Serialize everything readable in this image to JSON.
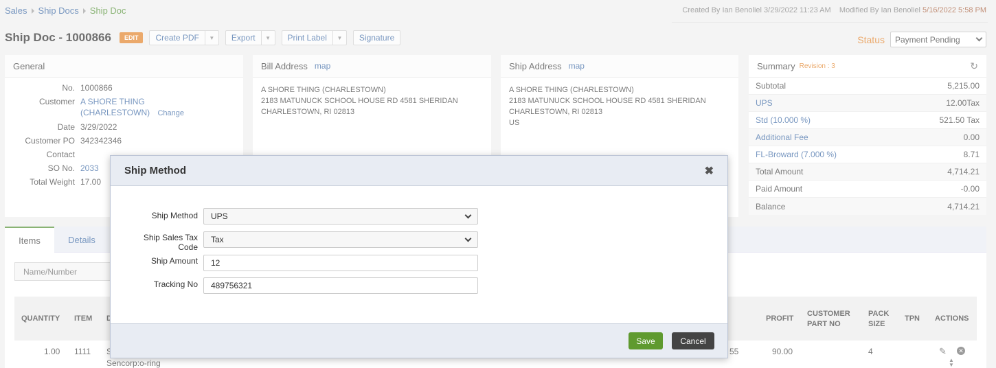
{
  "breadcrumb": [
    "Sales",
    "Ship Docs",
    "Ship Doc"
  ],
  "meta": {
    "created_label": "Created By",
    "created_by": "Ian Benoliel 3/29/2022 11:23 AM",
    "modified_label": "Modified By",
    "modified_by_name": "Ian Benoliel",
    "modified_date": "5/16/2022 5:58 PM"
  },
  "title": "Ship Doc - 1000866",
  "edit_badge": "EDIT",
  "toolbar": {
    "create_pdf": "Create PDF",
    "export": "Export",
    "print_label": "Print Label",
    "signature": "Signature"
  },
  "status": {
    "label": "Status",
    "value": "Payment Pending"
  },
  "general": {
    "title": "General",
    "rows": [
      {
        "k": "No.",
        "v": "1000866"
      },
      {
        "k": "Customer",
        "v": "A SHORE THING",
        "v2": "(CHARLESTOWN)",
        "change": "Change"
      },
      {
        "k": "Date",
        "v": "3/29/2022"
      },
      {
        "k": "Customer PO",
        "v": "342342346"
      },
      {
        "k": "Contact",
        "v": ""
      },
      {
        "k": "SO No.",
        "v": "2033"
      },
      {
        "k": "Total Weight",
        "v": "17.00"
      }
    ]
  },
  "bill": {
    "title": "Bill Address",
    "map": "map",
    "lines": [
      "A SHORE THING (CHARLESTOWN)",
      "2183 MATUNUCK SCHOOL HOUSE RD 4581 SHERIDAN",
      "CHARLESTOWN, RI 02813"
    ]
  },
  "ship": {
    "title": "Ship Address",
    "map": "map",
    "lines": [
      "A SHORE THING (CHARLESTOWN)",
      "2183 MATUNUCK SCHOOL HOUSE RD 4581 SHERIDAN",
      "CHARLESTOWN, RI 02813",
      "US"
    ]
  },
  "summary": {
    "title": "Summary",
    "revision": "Revision : 3",
    "rows": [
      {
        "k": "Subtotal",
        "v": "5,215.00"
      },
      {
        "k": "UPS",
        "v": "12.00Tax"
      },
      {
        "k": "Std (10.000 %)",
        "v": "521.50 Tax"
      },
      {
        "k": "Additional Fee",
        "v": "0.00"
      },
      {
        "k": "FL-Broward (7.000 %)",
        "v": "8.71"
      },
      {
        "k": "Total Amount",
        "v": "4,714.21"
      },
      {
        "k": "Paid Amount",
        "v": "-0.00"
      },
      {
        "k": "Balance",
        "v": "4,714.21"
      }
    ]
  },
  "tabs": [
    "Items",
    "Details"
  ],
  "search_placeholder": "Name/Number",
  "table": {
    "headers": [
      "QUANTITY",
      "ITEM",
      "D",
      "PROFIT",
      "CUSTOMER",
      "PART NO",
      "PACK",
      "SIZE",
      "TPN",
      "ACTIONS"
    ],
    "row": {
      "quantity": "1.00",
      "item": "1111",
      "desc_first": "S",
      "desc_second": "Sencorp:o-ring",
      "cut_value": "55",
      "profit": "90.00",
      "pack_size": "4"
    }
  },
  "modal": {
    "title": "Ship Method",
    "fields": {
      "ship_method_label": "Ship Method",
      "ship_method_value": "UPS",
      "tax_code_label": "Ship Sales Tax Code",
      "tax_code_value": "Tax",
      "ship_amount_label": "Ship Amount",
      "ship_amount_value": "12",
      "tracking_label": "Tracking No",
      "tracking_value": "489756321"
    },
    "save": "Save",
    "cancel": "Cancel"
  }
}
